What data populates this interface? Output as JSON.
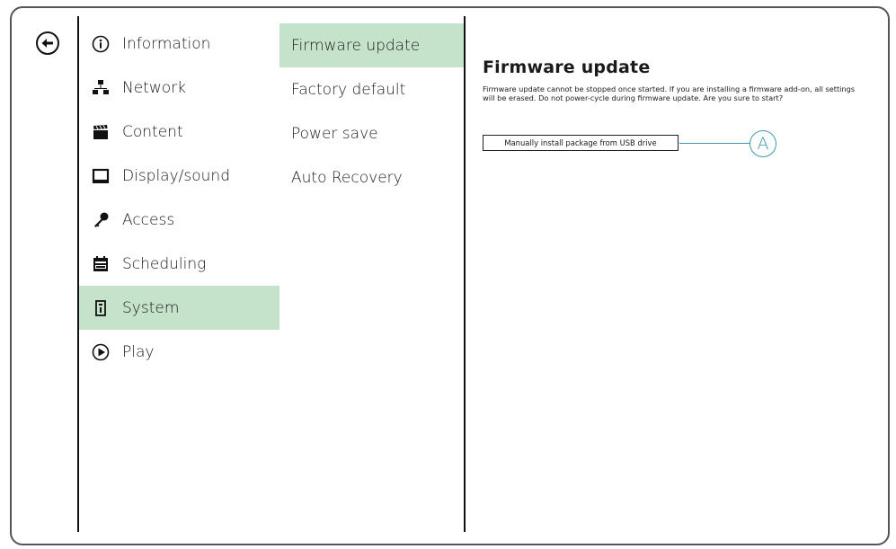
{
  "menu": {
    "items": [
      {
        "label": "Information",
        "icon": "info-icon"
      },
      {
        "label": "Network",
        "icon": "network-icon"
      },
      {
        "label": "Content",
        "icon": "clapperboard-icon"
      },
      {
        "label": "Display/sound",
        "icon": "monitor-icon"
      },
      {
        "label": "Access",
        "icon": "key-icon"
      },
      {
        "label": "Scheduling",
        "icon": "calendar-icon"
      },
      {
        "label": "System",
        "icon": "system-icon"
      },
      {
        "label": "Play",
        "icon": "play-icon"
      }
    ],
    "active": "System"
  },
  "submenu": {
    "items": [
      "Firmware update",
      "Factory default",
      "Power save",
      "Auto Recovery"
    ],
    "active": "Firmware update"
  },
  "content": {
    "title": "Firmware update",
    "description": "Firmware update cannot be stopped once started. If you are installing a firmware add-on, all settings will be erased. Do not power-cycle during firmware update. Are you sure to start?",
    "button_label": "Manually install package from USB drive",
    "callout_label": "A"
  },
  "colors": {
    "active_bg": "#c5e3cb",
    "callout": "#3a9aaa"
  }
}
